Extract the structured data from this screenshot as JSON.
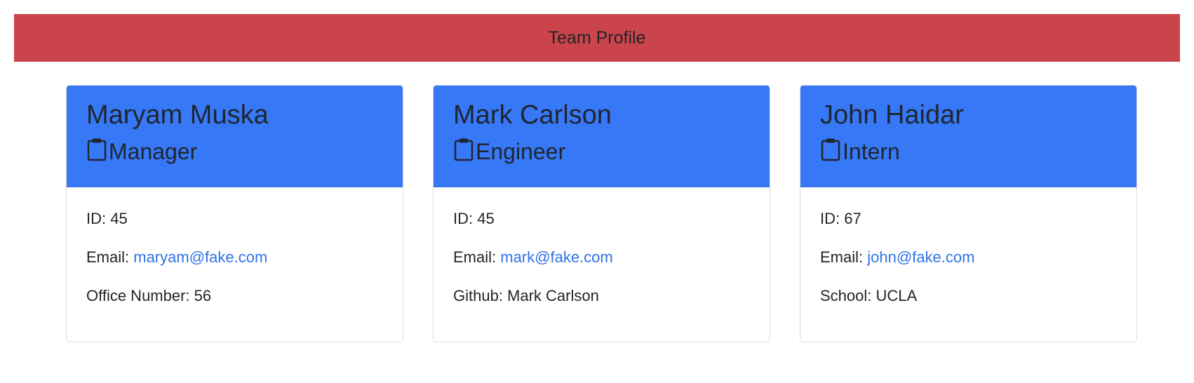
{
  "header": {
    "title": "Team Profile"
  },
  "labels": {
    "id": "ID: ",
    "email": "Email: ",
    "office": "Office Number: ",
    "github": "Github: ",
    "school": "School: "
  },
  "employees": [
    {
      "name": "Maryam Muska",
      "role": "Manager",
      "id": "45",
      "email": "maryam@fake.com",
      "extra": "56"
    },
    {
      "name": "Mark Carlson",
      "role": "Engineer",
      "id": "45",
      "email": "mark@fake.com",
      "extra": "Mark Carlson"
    },
    {
      "name": "John Haidar",
      "role": "Intern",
      "id": "67",
      "email": "john@fake.com",
      "extra": "UCLA"
    }
  ],
  "colors": {
    "banner": "#cc444b",
    "card_header": "#3778f6",
    "link": "#2f73e6"
  },
  "icons": {
    "role": "clipboard-icon"
  }
}
